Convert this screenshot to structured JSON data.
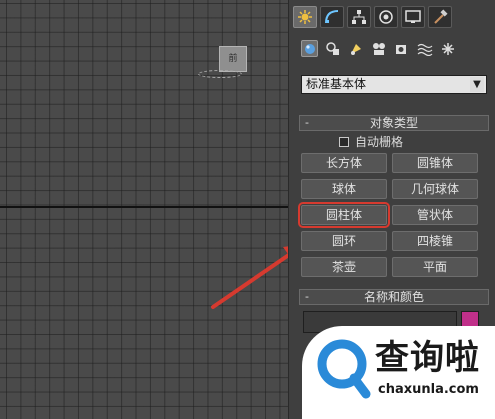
{
  "viewport": {
    "viewcube_label": "前"
  },
  "command_panel": {
    "tabs": [
      {
        "name": "create",
        "icon": "sun-star-icon",
        "active": true
      },
      {
        "name": "modify",
        "icon": "bend-curve-icon",
        "active": false
      },
      {
        "name": "hierarchy",
        "icon": "hierarchy-icon",
        "active": false
      },
      {
        "name": "motion",
        "icon": "motion-circle-icon",
        "active": false
      },
      {
        "name": "display",
        "icon": "monitor-icon",
        "active": false
      },
      {
        "name": "utilities",
        "icon": "hammer-icon",
        "active": false
      }
    ],
    "category_icons": [
      "geometry-sphere-icon",
      "shapes-icon",
      "lights-icon",
      "cameras-icon",
      "helpers-icon",
      "space-warps-icon",
      "systems-icon"
    ],
    "category_dropdown": "标准基本体",
    "object_type_rollout": {
      "title": "对象类型",
      "collapse_symbol": "-",
      "autogrid_label": "自动栅格",
      "buttons": [
        "长方体",
        "圆锥体",
        "球体",
        "几何球体",
        "圆柱体",
        "管状体",
        "圆环",
        "四棱锥",
        "茶壶",
        "平面"
      ],
      "highlighted": "圆柱体"
    },
    "name_color_rollout": {
      "title": "名称和颜色",
      "collapse_symbol": "-",
      "name_value": "",
      "color": "#c0308a"
    }
  },
  "annotation": {
    "arrow_color": "#d63a2f"
  },
  "watermark": {
    "title": "查询啦",
    "url": "chaxunla.com",
    "brand_color": "#2a8ad8"
  }
}
